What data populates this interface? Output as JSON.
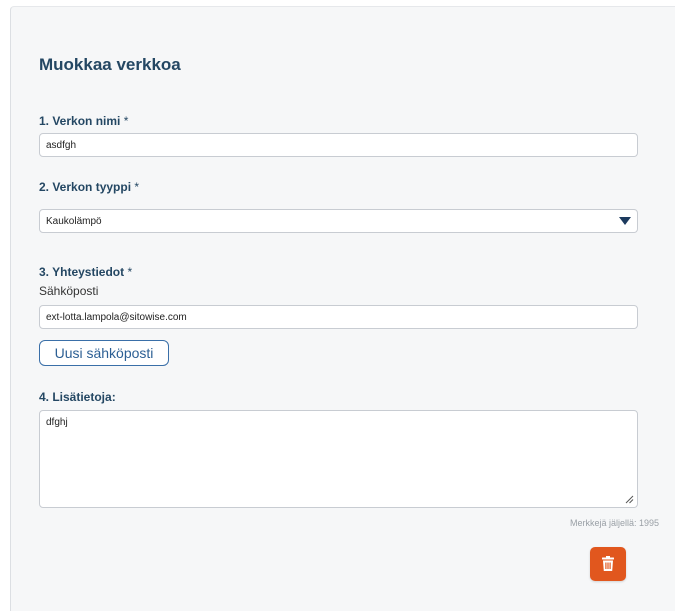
{
  "form": {
    "title": "Muokkaa verkkoa",
    "name_label": "1. Verkon nimi",
    "name_required": "*",
    "name_value": "asdfgh",
    "type_label": "2. Verkon tyyppi",
    "type_required": "*",
    "type_value": "Kaukolämpö",
    "contact_label": "3. Yhteystiedot",
    "contact_required": "*",
    "email_label": "Sähköposti",
    "email_value": "ext-lotta.lampola@sitowise.com",
    "new_email_button": "Uusi sähköposti",
    "extra_label": "4. Lisätietoja:",
    "extra_value": "dfghj",
    "chars_left": "Merkkejä jäljellä: 1995"
  },
  "icons": {
    "select_arrow": "caret-down-icon",
    "delete": "trash-icon",
    "resize": "resize-handle-icon"
  },
  "colors": {
    "heading": "#244763",
    "accent": "#3a6fa8",
    "danger": "#e1571e"
  }
}
